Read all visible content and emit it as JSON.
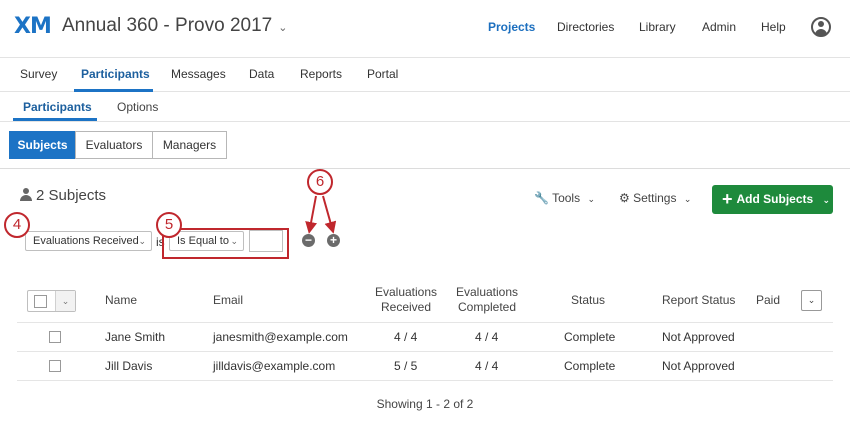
{
  "header": {
    "logo": "XM",
    "project_title": "Annual 360 - Provo 2017",
    "nav": [
      "Projects",
      "Directories",
      "Library",
      "Admin",
      "Help"
    ]
  },
  "tabs_primary": [
    "Survey",
    "Participants",
    "Messages",
    "Data",
    "Reports",
    "Portal"
  ],
  "tabs_secondary": [
    "Participants",
    "Options"
  ],
  "segments": [
    "Subjects",
    "Evaluators",
    "Managers"
  ],
  "subjects_count": "2 Subjects",
  "toolbar": {
    "tools": "Tools",
    "settings": "Settings",
    "add": "Add Subjects"
  },
  "filter": {
    "field": "Evaluations Received",
    "is": "is",
    "operator": "Is Equal to",
    "value": ""
  },
  "callouts": [
    "4",
    "5",
    "6"
  ],
  "table": {
    "headers": {
      "name": "Name",
      "email": "Email",
      "eval_received": [
        "Evaluations",
        "Received"
      ],
      "eval_completed": [
        "Evaluations",
        "Completed"
      ],
      "status": "Status",
      "report_status": "Report Status",
      "paid": "Paid"
    },
    "rows": [
      {
        "name": "Jane Smith",
        "email": "janesmith@example.com",
        "received": "4 / 4",
        "completed": "4 / 4",
        "status": "Complete",
        "report_status": "Not Approved"
      },
      {
        "name": "Jill Davis",
        "email": "jilldavis@example.com",
        "received": "5 / 5",
        "completed": "4 / 4",
        "status": "Complete",
        "report_status": "Not Approved"
      }
    ],
    "footer": "Showing 1 - 2 of 2"
  },
  "colors": {
    "accent": "#1c73c5",
    "add_button": "#1e8a3c",
    "callout": "#c0272d"
  }
}
